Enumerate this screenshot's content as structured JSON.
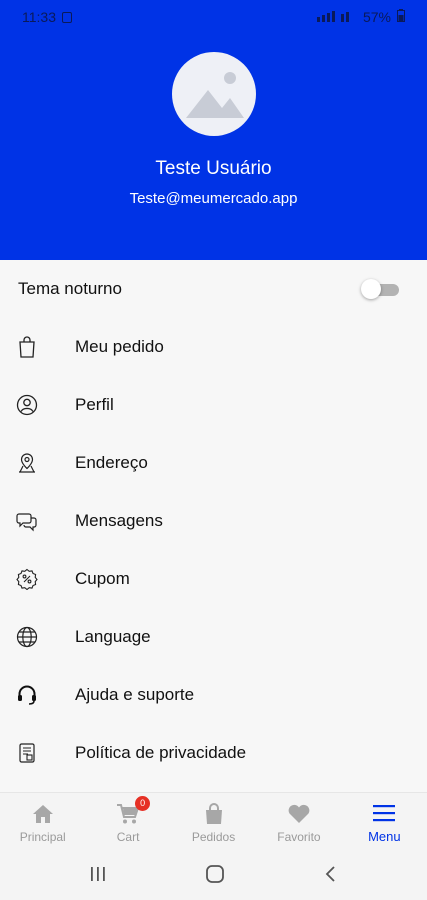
{
  "status_bar": {
    "time": "11:33",
    "battery": "57%"
  },
  "profile": {
    "name": "Teste Usuário",
    "email": "Teste@meumercado.app"
  },
  "settings": {
    "dark_mode_label": "Tema noturno",
    "dark_mode_on": false
  },
  "menu": {
    "items": [
      {
        "label": "Meu pedido",
        "icon": "shopping-bag-icon"
      },
      {
        "label": "Perfil",
        "icon": "user-circle-icon"
      },
      {
        "label": "Endereço",
        "icon": "location-pin-icon"
      },
      {
        "label": "Mensagens",
        "icon": "chat-bubbles-icon"
      },
      {
        "label": "Cupom",
        "icon": "coupon-icon"
      },
      {
        "label": "Language",
        "icon": "globe-icon"
      },
      {
        "label": "Ajuda e suporte",
        "icon": "headset-icon"
      },
      {
        "label": "Política de privacidade",
        "icon": "document-icon"
      }
    ]
  },
  "bottom_nav": {
    "items": [
      {
        "label": "Principal",
        "icon": "home-icon"
      },
      {
        "label": "Cart",
        "icon": "cart-icon",
        "badge": "0"
      },
      {
        "label": "Pedidos",
        "icon": "bag-icon"
      },
      {
        "label": "Favorito",
        "icon": "heart-icon"
      },
      {
        "label": "Menu",
        "icon": "menu-icon",
        "active": true
      }
    ]
  },
  "colors": {
    "primary": "#0033e6",
    "badge": "#e63025",
    "inactive": "#9a9a9a"
  }
}
